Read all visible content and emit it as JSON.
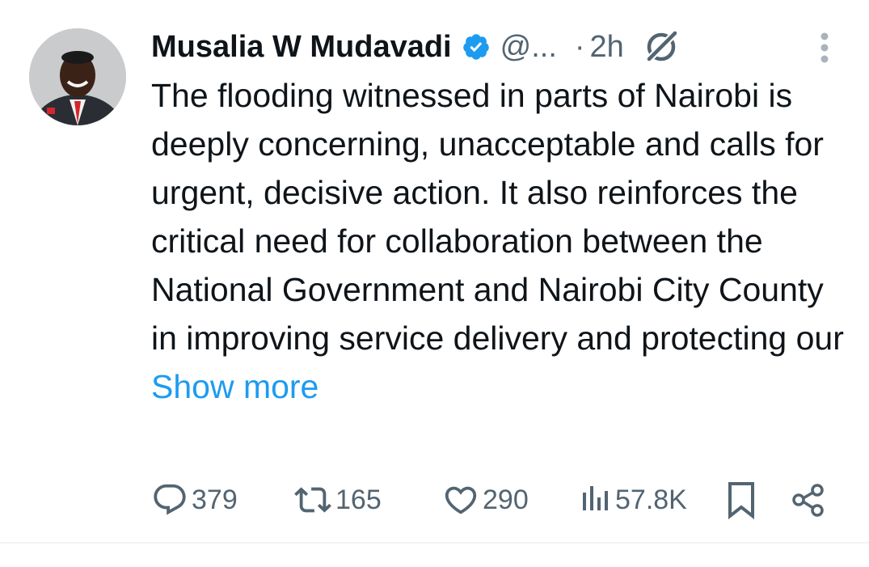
{
  "tweet": {
    "author": {
      "name": "Musalia W Mudavadi",
      "handle": "@...",
      "verified": true,
      "avatar_icon": "avatar-photo"
    },
    "time_separator": "·",
    "time": "2h",
    "text": "The flooding witnessed in parts of Nairobi is deeply concerning, unacceptable and calls for urgent, decisive action. It also reinforces the critical need for collaboration between the National Government and Nairobi City County in improving service delivery and protecting our",
    "show_more": "Show more",
    "metrics": {
      "replies": "379",
      "reposts": "165",
      "likes": "290",
      "views": "57.8K"
    }
  },
  "icons": {
    "verified": "verified-badge-icon",
    "grok": "grok-icon",
    "more": "more-vertical-icon",
    "reply": "reply-icon",
    "repost": "repost-icon",
    "like": "heart-icon",
    "views": "analytics-icon",
    "bookmark": "bookmark-icon",
    "share": "share-icon"
  },
  "colors": {
    "text": "#0f1419",
    "secondary": "#536471",
    "accent": "#1d9bf0",
    "divider": "#eff3f4"
  }
}
